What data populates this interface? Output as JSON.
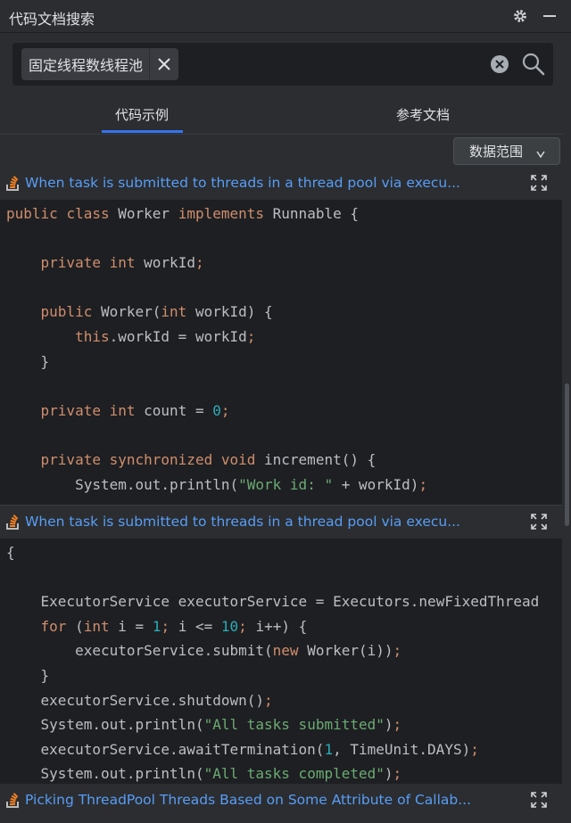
{
  "window": {
    "title": "代码文档搜索",
    "settings_icon": "gear-icon",
    "minimize_icon": "minimize-icon"
  },
  "search": {
    "chip_text": "固定线程数线程池",
    "remove_chip_icon": "close-icon",
    "clear_icon": "clear-circle-icon",
    "search_icon": "search-icon"
  },
  "tabs": [
    {
      "label": "代码示例",
      "active": true
    },
    {
      "label": "参考文档",
      "active": false
    }
  ],
  "filter": {
    "label": "数据范围",
    "chevron_icon": "chevron-down-icon"
  },
  "results": [
    {
      "title": "When task is submitted to threads in a thread pool via execu...",
      "icon": "stackoverflow-icon",
      "expand_icon": "expand-icon",
      "code_lines": [
        "public class Worker implements Runnable {",
        "",
        "    private int workId;",
        "",
        "    public Worker(int workId) {",
        "        this.workId = workId;",
        "    }",
        "",
        "    private int count = 0;",
        "",
        "    private synchronized void increment() {",
        "        System.out.println(\"Work id: \" + workId);"
      ]
    },
    {
      "title": "When task is submitted to threads in a thread pool via execu...",
      "icon": "stackoverflow-icon",
      "expand_icon": "expand-icon",
      "code_lines": [
        "{",
        "",
        "    ExecutorService executorService = Executors.newFixedThread",
        "    for (int i = 1; i <= 10; i++) {",
        "        executorService.submit(new Worker(i));",
        "    }",
        "    executorService.shutdown();",
        "    System.out.println(\"All tasks submitted\");",
        "    executorService.awaitTermination(1, TimeUnit.DAYS);",
        "    System.out.println(\"All tasks completed\");",
        "}"
      ]
    },
    {
      "title": "Picking ThreadPool Threads Based on Some Attribute of Callab...",
      "icon": "stackoverflow-icon",
      "expand_icon": "expand-icon"
    }
  ],
  "colors": {
    "background": "#2b2d30",
    "code_bg": "#1e1f22",
    "link": "#589df6",
    "accent": "#3574f0",
    "keyword": "#cf8e6d",
    "string": "#6aab73",
    "number": "#2aacb8"
  }
}
